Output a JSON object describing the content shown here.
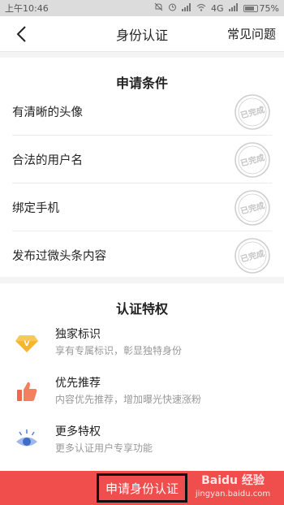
{
  "status": {
    "time": "上午10:46",
    "network": "4G",
    "battery": "75%",
    "icons": [
      "mute-icon",
      "alarm-icon",
      "signal-icon",
      "signal-icon",
      "wifi-icon"
    ]
  },
  "nav": {
    "back_icon": "chevron-left-icon",
    "title": "身份认证",
    "faq": "常见问题"
  },
  "conditions": {
    "title": "申请条件",
    "stamp_text": "已完成",
    "items": [
      {
        "label": "有清晰的头像"
      },
      {
        "label": "合法的用户名"
      },
      {
        "label": "绑定手机"
      },
      {
        "label": "发布过微头条内容"
      }
    ]
  },
  "privileges": {
    "title": "认证特权",
    "items": [
      {
        "icon": "diamond-v-icon",
        "name": "独家标识",
        "desc": "享有专属标识，彰显独特身份"
      },
      {
        "icon": "thumbs-up-icon",
        "name": "优先推荐",
        "desc": "内容优先推荐，增加曝光快速涨粉"
      },
      {
        "icon": "eye-icon",
        "name": "更多特权",
        "desc": "更多认证用户专享功能"
      }
    ]
  },
  "apply": {
    "label": "申请身份认证"
  },
  "watermark": {
    "brand": "Baidu 经验",
    "url": "jingyan.baidu.com"
  },
  "colors": {
    "accent": "#f04d4d",
    "stamp": "#cfcfcf",
    "diamond": "#f5b52e",
    "thumb": "#ee6a4c",
    "eye": "#5a86d8"
  }
}
